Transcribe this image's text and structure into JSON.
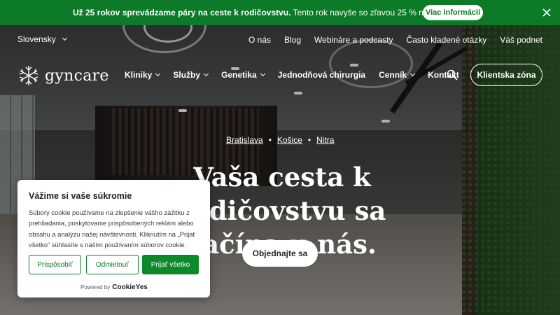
{
  "announcement": {
    "bold_text": "Už 25 rokov sprevádzame páry na ceste k rodičovstvu.",
    "text": "Tento rok navyše so zľavou 25 % na ICSI a IUI.",
    "button": "Viac informácií",
    "close_icon": "close-icon"
  },
  "topnav": {
    "language": "Slovensky",
    "links": [
      "O nás",
      "Blog",
      "Webináre a podcasty",
      "Často kladené otázky",
      "Váš podnet"
    ]
  },
  "brand": {
    "name": "gyncare",
    "icon": "snowflake-logo-icon"
  },
  "mainnav": {
    "items": [
      {
        "label": "Kliniky",
        "dropdown": true
      },
      {
        "label": "Služby",
        "dropdown": true
      },
      {
        "label": "Genetika",
        "dropdown": true
      },
      {
        "label": "Jednodňová chirurgia",
        "dropdown": false
      },
      {
        "label": "Cenník",
        "dropdown": true
      },
      {
        "label": "Kontakt",
        "dropdown": false
      }
    ],
    "search_icon": "search-icon",
    "client_button": "Klientska zóna"
  },
  "hero": {
    "locations": [
      "Bratislava",
      "Košice",
      "Nitra"
    ],
    "separator": "•",
    "title_line1": "Vaša cesta k rodičovstvu sa",
    "title_line2": "začína u nás.",
    "cta": "Objednajte sa"
  },
  "cookie": {
    "title": "Vážime si vaše súkromie",
    "body": "Súbory cookie používame na zlepšenie vášho zážitku z prehliadania, poskytovanie prispôsobených reklám alebo obsahu a analýzu našej návštevnosti. Kliknutím na „Prijať všetko“ súhlasíte s naším používaním súborov cookie.",
    "customize": "Prispôsobiť",
    "reject": "Odmietnuť",
    "accept": "Prijať všetko",
    "powered_prefix": "Powered by",
    "powered_brand": "CookieYes"
  },
  "colors": {
    "brand_green": "#0c7a26",
    "white": "#ffffff"
  }
}
